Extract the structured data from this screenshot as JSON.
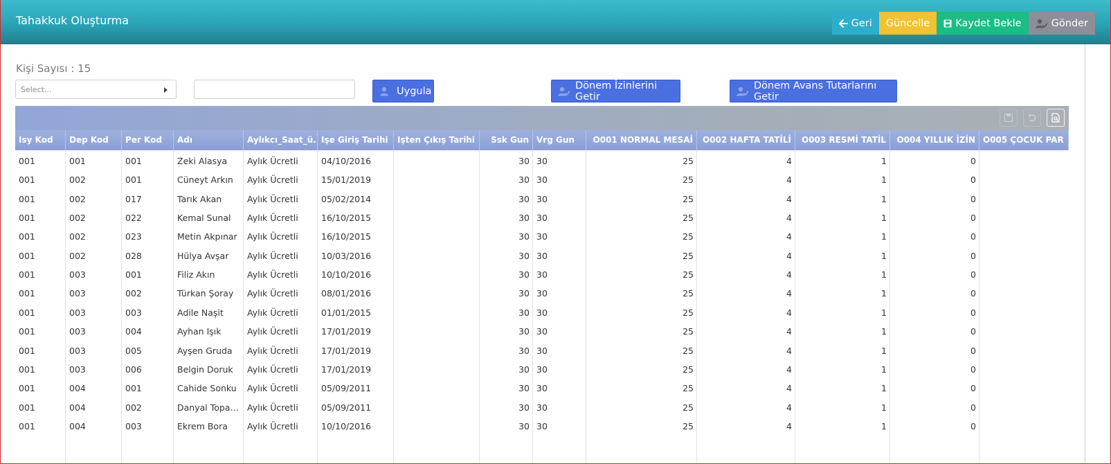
{
  "header": {
    "title": "Tahakkuk Oluşturma",
    "buttons": {
      "geri": "Geri",
      "guncelle": "Güncelle",
      "kaydet": "Kaydet Bekle",
      "gonder": "Gönder"
    }
  },
  "toolbar": {
    "kisi_sayisi": "Kişi Sayısı : 15",
    "select_placeholder": "Select...",
    "search_value": "",
    "uygula": "Uygula",
    "izin": "Dönem İzinlerini Getir",
    "avans": "Dönem Avans Tutarlarını Getir"
  },
  "grid_toolbar_icons": [
    "save-icon",
    "undo-icon",
    "export-icon"
  ],
  "colors": {
    "header_gradient_top": "#3cbccc",
    "header_gradient_bottom": "#227d8c",
    "accent_blue": "#4a6fe0",
    "geri": "#2eaecb",
    "guncelle": "#f1c232",
    "kaydet": "#1cbc86",
    "gonder": "#8c8f98"
  },
  "table": {
    "columns": [
      "Isy Kod",
      "Dep Kod",
      "Per Kod",
      "Adı",
      "Aylıkcı_Saat_ü...",
      "Işe Giriş Tarihi",
      "Işten Çıkış Tarihi",
      "Ssk Gun",
      "Vrg Gun",
      "O001 NORMAL MESAİ",
      "O002 HAFTA TATİLİ",
      "O003 RESMİ TATİL",
      "O004 YILLIK İZİN",
      "O005 ÇOCUK PAR"
    ],
    "rows": [
      [
        "001",
        "001",
        "001",
        "Zeki Alasya",
        "Aylık Ücretli",
        "04/10/2016",
        "",
        "30",
        "30",
        "25",
        "4",
        "1",
        "0",
        ""
      ],
      [
        "001",
        "002",
        "001",
        "Cüneyt Arkın",
        "Aylık Ücretli",
        "15/01/2019",
        "",
        "30",
        "30",
        "25",
        "4",
        "1",
        "0",
        ""
      ],
      [
        "001",
        "002",
        "017",
        "Tarık Akan",
        "Aylık Ücretli",
        "05/02/2014",
        "",
        "30",
        "30",
        "25",
        "4",
        "1",
        "0",
        ""
      ],
      [
        "001",
        "002",
        "022",
        "Kemal Sunal",
        "Aylık Ücretli",
        "16/10/2015",
        "",
        "30",
        "30",
        "25",
        "4",
        "1",
        "0",
        ""
      ],
      [
        "001",
        "002",
        "023",
        "Metin Akpınar",
        "Aylık Ücretli",
        "16/10/2015",
        "",
        "30",
        "30",
        "25",
        "4",
        "1",
        "0",
        ""
      ],
      [
        "001",
        "002",
        "028",
        "Hülya Avşar",
        "Aylık Ücretli",
        "10/03/2016",
        "",
        "30",
        "30",
        "25",
        "4",
        "1",
        "0",
        ""
      ],
      [
        "001",
        "003",
        "001",
        "Filiz Akın",
        "Aylık Ücretli",
        "10/10/2016",
        "",
        "30",
        "30",
        "25",
        "4",
        "1",
        "0",
        ""
      ],
      [
        "001",
        "003",
        "002",
        "Türkan Şoray",
        "Aylık Ücretli",
        "08/01/2016",
        "",
        "30",
        "30",
        "25",
        "4",
        "1",
        "0",
        ""
      ],
      [
        "001",
        "003",
        "003",
        "Adile Naşit",
        "Aylık Ücretli",
        "01/01/2015",
        "",
        "30",
        "30",
        "25",
        "4",
        "1",
        "0",
        ""
      ],
      [
        "001",
        "003",
        "004",
        "Ayhan Işık",
        "Aylık Ücretli",
        "17/01/2019",
        "",
        "30",
        "30",
        "25",
        "4",
        "1",
        "0",
        ""
      ],
      [
        "001",
        "003",
        "005",
        "Ayşen Gruda",
        "Aylık Ücretli",
        "17/01/2019",
        "",
        "30",
        "30",
        "25",
        "4",
        "1",
        "0",
        ""
      ],
      [
        "001",
        "003",
        "006",
        "Belgin Doruk",
        "Aylık Ücretli",
        "17/01/2019",
        "",
        "30",
        "30",
        "25",
        "4",
        "1",
        "0",
        ""
      ],
      [
        "001",
        "004",
        "001",
        "Cahide Sonku",
        "Aylık Ücretli",
        "05/09/2011",
        "",
        "30",
        "30",
        "25",
        "4",
        "1",
        "0",
        ""
      ],
      [
        "001",
        "004",
        "002",
        "Danyal Topat...",
        "Aylık Ücretli",
        "05/09/2011",
        "",
        "30",
        "30",
        "25",
        "4",
        "1",
        "0",
        ""
      ],
      [
        "001",
        "004",
        "003",
        "Ekrem Bora",
        "Aylık Ücretli",
        "10/10/2016",
        "",
        "30",
        "30",
        "25",
        "4",
        "1",
        "0",
        ""
      ]
    ]
  }
}
